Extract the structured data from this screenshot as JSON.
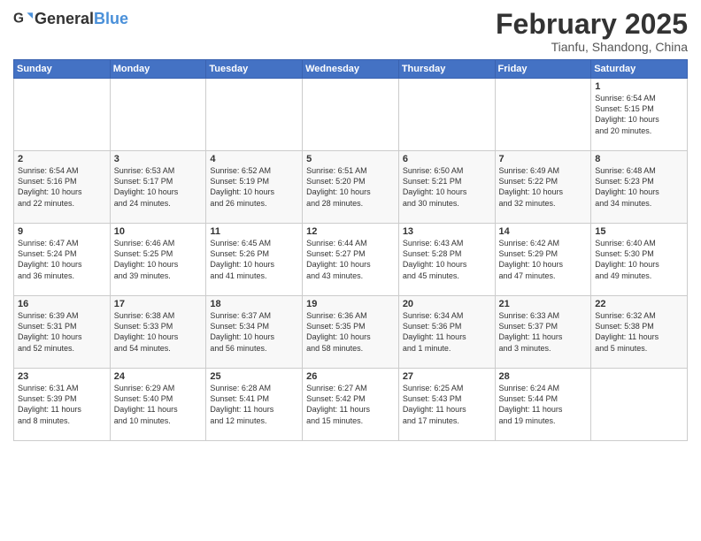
{
  "header": {
    "logo_general": "General",
    "logo_blue": "Blue",
    "title": "February 2025",
    "subtitle": "Tianfu, Shandong, China"
  },
  "weekdays": [
    "Sunday",
    "Monday",
    "Tuesday",
    "Wednesday",
    "Thursday",
    "Friday",
    "Saturday"
  ],
  "weeks": [
    [
      {
        "day": "",
        "info": ""
      },
      {
        "day": "",
        "info": ""
      },
      {
        "day": "",
        "info": ""
      },
      {
        "day": "",
        "info": ""
      },
      {
        "day": "",
        "info": ""
      },
      {
        "day": "",
        "info": ""
      },
      {
        "day": "1",
        "info": "Sunrise: 6:54 AM\nSunset: 5:15 PM\nDaylight: 10 hours\nand 20 minutes."
      }
    ],
    [
      {
        "day": "2",
        "info": "Sunrise: 6:54 AM\nSunset: 5:16 PM\nDaylight: 10 hours\nand 22 minutes."
      },
      {
        "day": "3",
        "info": "Sunrise: 6:53 AM\nSunset: 5:17 PM\nDaylight: 10 hours\nand 24 minutes."
      },
      {
        "day": "4",
        "info": "Sunrise: 6:52 AM\nSunset: 5:19 PM\nDaylight: 10 hours\nand 26 minutes."
      },
      {
        "day": "5",
        "info": "Sunrise: 6:51 AM\nSunset: 5:20 PM\nDaylight: 10 hours\nand 28 minutes."
      },
      {
        "day": "6",
        "info": "Sunrise: 6:50 AM\nSunset: 5:21 PM\nDaylight: 10 hours\nand 30 minutes."
      },
      {
        "day": "7",
        "info": "Sunrise: 6:49 AM\nSunset: 5:22 PM\nDaylight: 10 hours\nand 32 minutes."
      },
      {
        "day": "8",
        "info": "Sunrise: 6:48 AM\nSunset: 5:23 PM\nDaylight: 10 hours\nand 34 minutes."
      }
    ],
    [
      {
        "day": "9",
        "info": "Sunrise: 6:47 AM\nSunset: 5:24 PM\nDaylight: 10 hours\nand 36 minutes."
      },
      {
        "day": "10",
        "info": "Sunrise: 6:46 AM\nSunset: 5:25 PM\nDaylight: 10 hours\nand 39 minutes."
      },
      {
        "day": "11",
        "info": "Sunrise: 6:45 AM\nSunset: 5:26 PM\nDaylight: 10 hours\nand 41 minutes."
      },
      {
        "day": "12",
        "info": "Sunrise: 6:44 AM\nSunset: 5:27 PM\nDaylight: 10 hours\nand 43 minutes."
      },
      {
        "day": "13",
        "info": "Sunrise: 6:43 AM\nSunset: 5:28 PM\nDaylight: 10 hours\nand 45 minutes."
      },
      {
        "day": "14",
        "info": "Sunrise: 6:42 AM\nSunset: 5:29 PM\nDaylight: 10 hours\nand 47 minutes."
      },
      {
        "day": "15",
        "info": "Sunrise: 6:40 AM\nSunset: 5:30 PM\nDaylight: 10 hours\nand 49 minutes."
      }
    ],
    [
      {
        "day": "16",
        "info": "Sunrise: 6:39 AM\nSunset: 5:31 PM\nDaylight: 10 hours\nand 52 minutes."
      },
      {
        "day": "17",
        "info": "Sunrise: 6:38 AM\nSunset: 5:33 PM\nDaylight: 10 hours\nand 54 minutes."
      },
      {
        "day": "18",
        "info": "Sunrise: 6:37 AM\nSunset: 5:34 PM\nDaylight: 10 hours\nand 56 minutes."
      },
      {
        "day": "19",
        "info": "Sunrise: 6:36 AM\nSunset: 5:35 PM\nDaylight: 10 hours\nand 58 minutes."
      },
      {
        "day": "20",
        "info": "Sunrise: 6:34 AM\nSunset: 5:36 PM\nDaylight: 11 hours\nand 1 minute."
      },
      {
        "day": "21",
        "info": "Sunrise: 6:33 AM\nSunset: 5:37 PM\nDaylight: 11 hours\nand 3 minutes."
      },
      {
        "day": "22",
        "info": "Sunrise: 6:32 AM\nSunset: 5:38 PM\nDaylight: 11 hours\nand 5 minutes."
      }
    ],
    [
      {
        "day": "23",
        "info": "Sunrise: 6:31 AM\nSunset: 5:39 PM\nDaylight: 11 hours\nand 8 minutes."
      },
      {
        "day": "24",
        "info": "Sunrise: 6:29 AM\nSunset: 5:40 PM\nDaylight: 11 hours\nand 10 minutes."
      },
      {
        "day": "25",
        "info": "Sunrise: 6:28 AM\nSunset: 5:41 PM\nDaylight: 11 hours\nand 12 minutes."
      },
      {
        "day": "26",
        "info": "Sunrise: 6:27 AM\nSunset: 5:42 PM\nDaylight: 11 hours\nand 15 minutes."
      },
      {
        "day": "27",
        "info": "Sunrise: 6:25 AM\nSunset: 5:43 PM\nDaylight: 11 hours\nand 17 minutes."
      },
      {
        "day": "28",
        "info": "Sunrise: 6:24 AM\nSunset: 5:44 PM\nDaylight: 11 hours\nand 19 minutes."
      },
      {
        "day": "",
        "info": ""
      }
    ]
  ]
}
